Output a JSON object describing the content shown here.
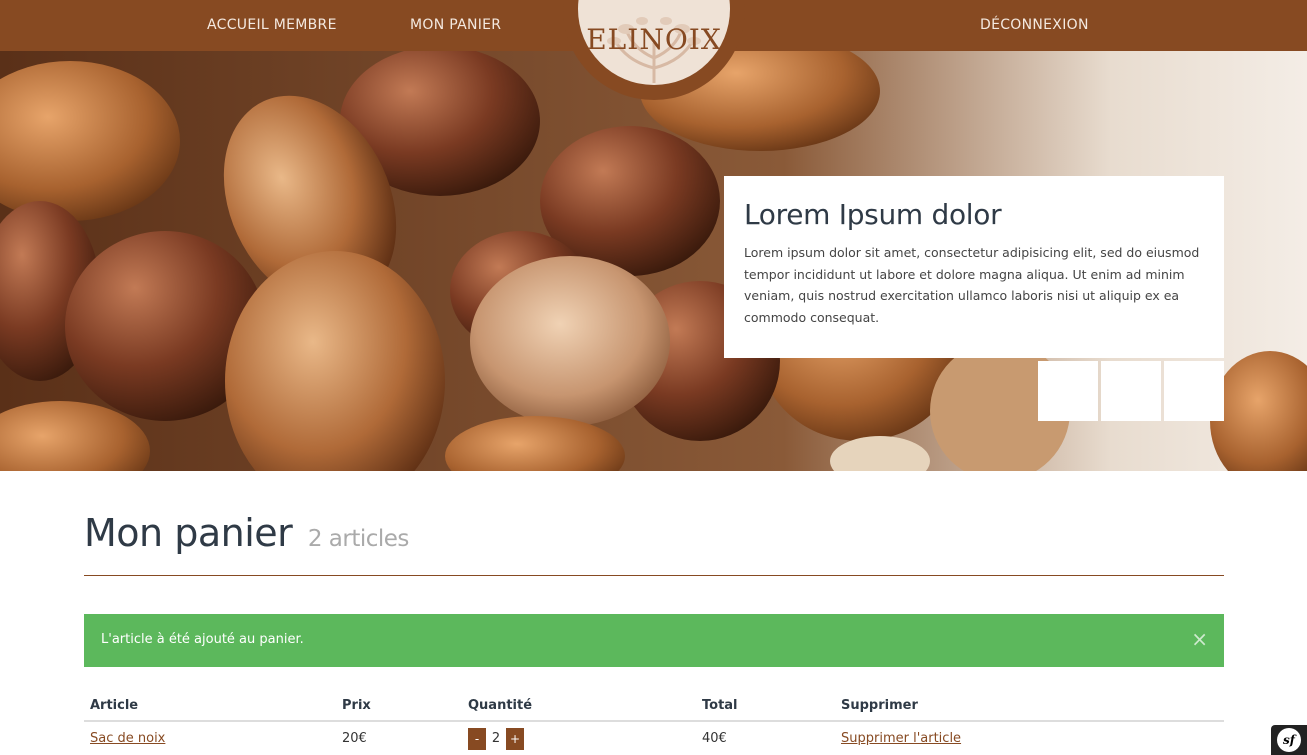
{
  "nav": {
    "accueil": "ACCUEIL MEMBRE",
    "panier": "MON PANIER",
    "deconnexion": "DÉCONNEXION",
    "logo_text": "ELINOIX"
  },
  "hero": {
    "caption_title": "Lorem Ipsum dolor",
    "caption_text": "Lorem ipsum dolor sit amet, consectetur adipisicing elit, sed do eiusmod tempor incididunt ut labore et dolore magna aliqua. Ut enim ad minim veniam, quis nostrud exercitation ullamco laboris nisi ut aliquip ex ea commodo consequat.",
    "controls": [
      "arrow-left-icon",
      "arrow-right-icon",
      "minus-icon"
    ]
  },
  "page": {
    "title": "Mon panier",
    "subtitle": "2 articles"
  },
  "alert": {
    "message": "L'article à été ajouté au panier.",
    "close": "×"
  },
  "table": {
    "headers": {
      "article": "Article",
      "prix": "Prix",
      "quantite": "Quantité",
      "total": "Total",
      "supprimer": "Supprimer"
    },
    "rows": [
      {
        "article": "Sac de noix",
        "prix": "20€",
        "qty_minus": "-",
        "quantite": "2",
        "qty_plus": "+",
        "total": "40€",
        "supprimer": "Supprimer l'article"
      }
    ]
  },
  "toolbar": {
    "sf_label": "sf"
  },
  "colors": {
    "brand": "#874a22",
    "alert_success": "#5cb85c"
  }
}
